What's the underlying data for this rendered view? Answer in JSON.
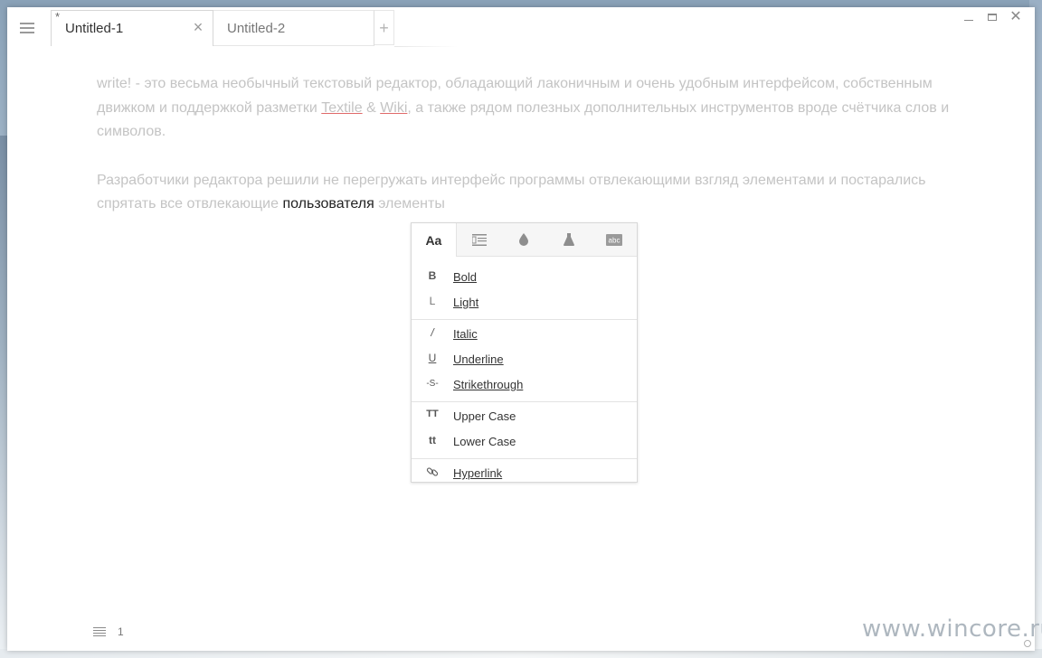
{
  "window": {
    "menu_icon": "hamburger-menu-icon"
  },
  "tabs": [
    {
      "label": "Untitled-1",
      "modified_marker": "*",
      "close_glyph": "×"
    },
    {
      "label": "Untitled-2"
    }
  ],
  "new_tab_glyph": "+",
  "window_controls": {
    "minimize_icon": "minimize-icon",
    "maximize_icon": "maximize-icon",
    "close_glyph": "✕"
  },
  "document": {
    "p1_before": "write! - это весьма необычный текстовый редактор, обладающий лаконичным и очень удобным интерфейсом, собственным движком и поддержкой разметки ",
    "p1_link1": "Textile",
    "p1_amp": " & ",
    "p1_link2": "Wiki",
    "p1_after": ", а также рядом полезных дополнительных инструментов вроде счётчика слов и символов.",
    "p2_before": "Разработчики редактора решили не перегружать интерфейс программы отвлекающими взгляд элементами и постарались спрятать все отвлекающие ",
    "p2_selected": "пользователя",
    "p2_after": " элементы"
  },
  "format_popup": {
    "tabs": [
      {
        "label": "Aa",
        "icon": "font-icon",
        "active": true
      },
      {
        "icon": "paragraph-icon"
      },
      {
        "icon": "color-drop-icon"
      },
      {
        "icon": "flask-icon"
      },
      {
        "icon": "abc-spellcheck-icon",
        "glyph": "abc"
      }
    ],
    "items": [
      {
        "icon_glyph": "B",
        "label": "Bold"
      },
      {
        "icon_glyph": "L",
        "label": "Light"
      },
      {
        "icon_glyph": "/",
        "label": "Italic"
      },
      {
        "icon_glyph": "U",
        "label": "Underline"
      },
      {
        "icon_glyph": "-S-",
        "label": "Strikethrough"
      },
      {
        "icon_glyph": "TT",
        "label": "Upper Case"
      },
      {
        "icon_glyph": "tt",
        "label": "Lower Case"
      },
      {
        "icon_glyph": "",
        "label": "Hyperlink",
        "icon": "link-icon"
      }
    ]
  },
  "statusbar": {
    "icon": "document-lines-icon",
    "line_number": "1"
  },
  "watermark": "www.wincore.ru",
  "colors": {
    "accent_text": "#333333",
    "faded_text": "#c4c4c4",
    "spell_error": "#e06a6a"
  }
}
